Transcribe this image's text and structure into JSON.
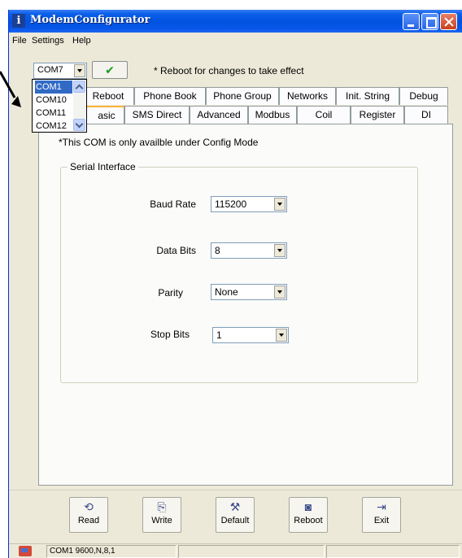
{
  "window": {
    "title": "ModemConfigurator",
    "app_icon_glyph": "i"
  },
  "menu": [
    "File",
    "Settings",
    "Help"
  ],
  "toolbar": {
    "com_selected": "COM7",
    "apply_icon": "✔",
    "note": "* Reboot for changes to take effect"
  },
  "com_dropdown": {
    "options": [
      "COM1",
      "COM10",
      "COM11",
      "COM12"
    ],
    "selected_index": 0
  },
  "tabs_row1": [
    "Reboot",
    "Phone Book",
    "Phone Group",
    "Networks",
    "Init. String",
    "Debug"
  ],
  "tabs_row2": [
    "asic",
    "SMS Direct",
    "Advanced",
    "Modbus",
    "Coil",
    "Register",
    "DI"
  ],
  "panel": {
    "note": "*This COM is only availble under Config Mode",
    "group_title": "Serial Interface",
    "fields": [
      {
        "label": "Baud Rate",
        "value": "115200"
      },
      {
        "label": "Data Bits",
        "value": "8"
      },
      {
        "label": "Parity",
        "value": "None"
      },
      {
        "label": "Stop Bits",
        "value": "1"
      }
    ]
  },
  "buttons": [
    {
      "label": "Read",
      "icon": "⟲"
    },
    {
      "label": "Write",
      "icon": "⎘"
    },
    {
      "label": "Default",
      "icon": "⚒"
    },
    {
      "label": "Reboot",
      "icon": "◙"
    },
    {
      "label": "Exit",
      "icon": "⇥"
    }
  ],
  "status": {
    "connection": "COM1 9600,N,8,1"
  },
  "colors": {
    "titlebar": "#0052e0",
    "selection": "#316ac5",
    "active_tab_accent": "#f8b33b"
  }
}
